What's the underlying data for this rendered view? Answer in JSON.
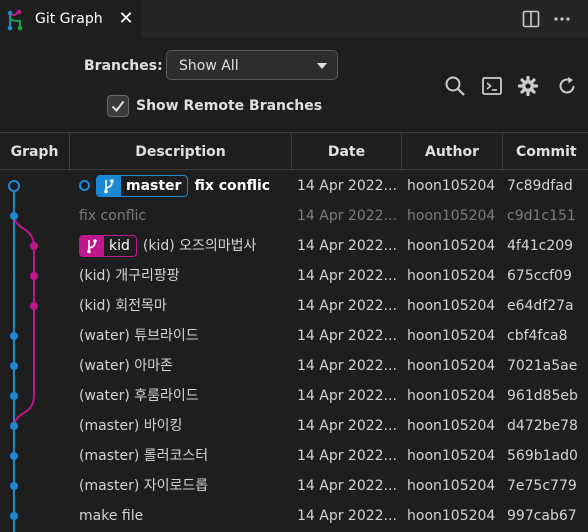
{
  "tab": {
    "title": "Git Graph",
    "close_symbol": "✕"
  },
  "controls": {
    "branches_label": "Branches:",
    "branches_value": "Show All",
    "show_remote_label": "Show Remote Branches",
    "show_remote_checked": true
  },
  "table": {
    "headers": {
      "graph": "Graph",
      "description": "Description",
      "date": "Date",
      "author": "Author",
      "commit": "Commit"
    },
    "rows": [
      {
        "ref": "master",
        "message": "fix conflic",
        "date": "14 Apr 2022...",
        "author": "hoon105204",
        "commit": "7c89dfad"
      },
      {
        "message": "fix conflic",
        "date": "14 Apr 2022...",
        "author": "hoon105204",
        "commit": "c9d1c151"
      },
      {
        "ref": "kid",
        "message": "(kid) 오즈의마법사",
        "date": "14 Apr 2022...",
        "author": "hoon105204",
        "commit": "4f41c209"
      },
      {
        "message": "(kid) 개구리팡팡",
        "date": "14 Apr 2022...",
        "author": "hoon105204",
        "commit": "675ccf09"
      },
      {
        "message": "(kid) 회전목마",
        "date": "14 Apr 2022...",
        "author": "hoon105204",
        "commit": "e64df27a"
      },
      {
        "message": "(water) 튜브라이드",
        "date": "14 Apr 2022...",
        "author": "hoon105204",
        "commit": "cbf4fca8"
      },
      {
        "message": "(water) 아마존",
        "date": "14 Apr 2022...",
        "author": "hoon105204",
        "commit": "7021a5ae"
      },
      {
        "message": "(water) 후룸라이드",
        "date": "14 Apr 2022...",
        "author": "hoon105204",
        "commit": "961d85eb"
      },
      {
        "message": "(master) 바이킹",
        "date": "14 Apr 2022...",
        "author": "hoon105204",
        "commit": "d472be78"
      },
      {
        "message": "(master) 롤러코스터",
        "date": "14 Apr 2022...",
        "author": "hoon105204",
        "commit": "569b1ad0"
      },
      {
        "message": "(master) 자이로드롭",
        "date": "14 Apr 2022...",
        "author": "hoon105204",
        "commit": "7e75c779"
      },
      {
        "message": "make file",
        "date": "14 Apr 2022...",
        "author": "hoon105204",
        "commit": "997cab67"
      }
    ]
  },
  "colors": {
    "master_branch": "#1a8ad4",
    "kid_branch": "#c0168e",
    "background": "#1e1e1e"
  },
  "icons": [
    "git-graph-icon",
    "close-icon",
    "split-editor-icon",
    "more-actions-icon",
    "search-icon",
    "terminal-icon",
    "gear-icon",
    "refresh-icon",
    "branch-icon",
    "checkmark-icon"
  ]
}
